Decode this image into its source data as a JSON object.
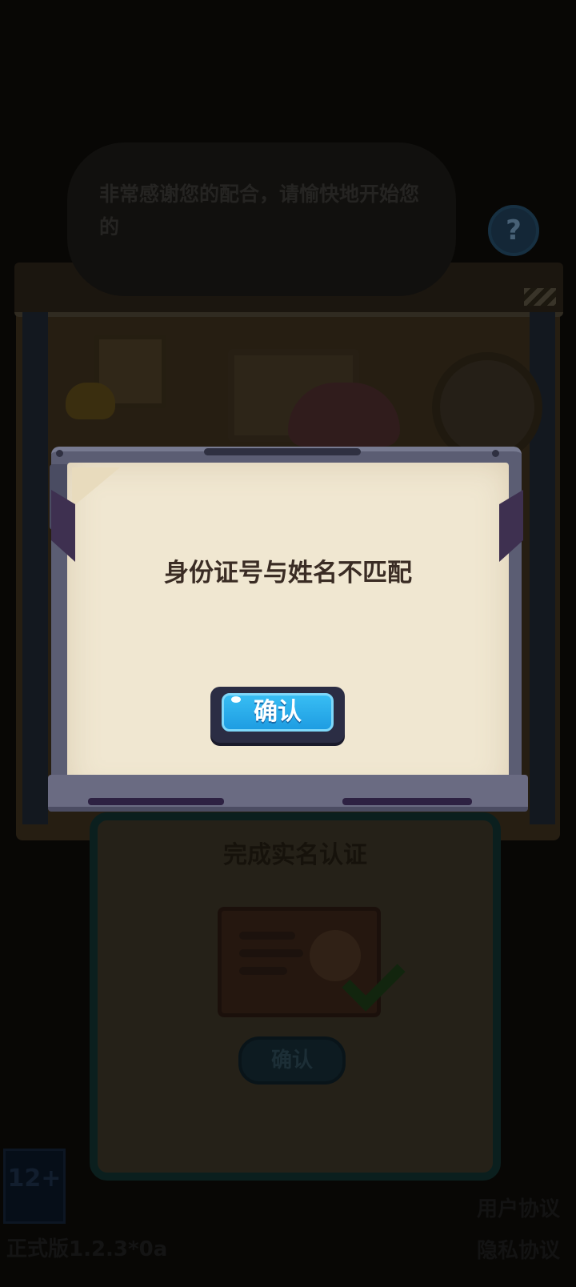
{
  "speech_bubble": {
    "text": "非常感谢您的配合，请愉快地开始您的"
  },
  "help": {
    "icon": "question-icon",
    "glyph": "?"
  },
  "background_panel": {
    "title": "完成实名认证",
    "confirm_label": "确认"
  },
  "footer": {
    "badge": "12+",
    "version": "正式版1.2.3*0a",
    "user_agreement": "用户协议",
    "privacy_policy": "隐私协议"
  },
  "dialog": {
    "message": "身份证号与姓名不匹配",
    "confirm_label": "确认"
  },
  "colors": {
    "button_blue": "#1e9de2",
    "paper": "#f0e7d1",
    "frame": "#5b5d73"
  }
}
